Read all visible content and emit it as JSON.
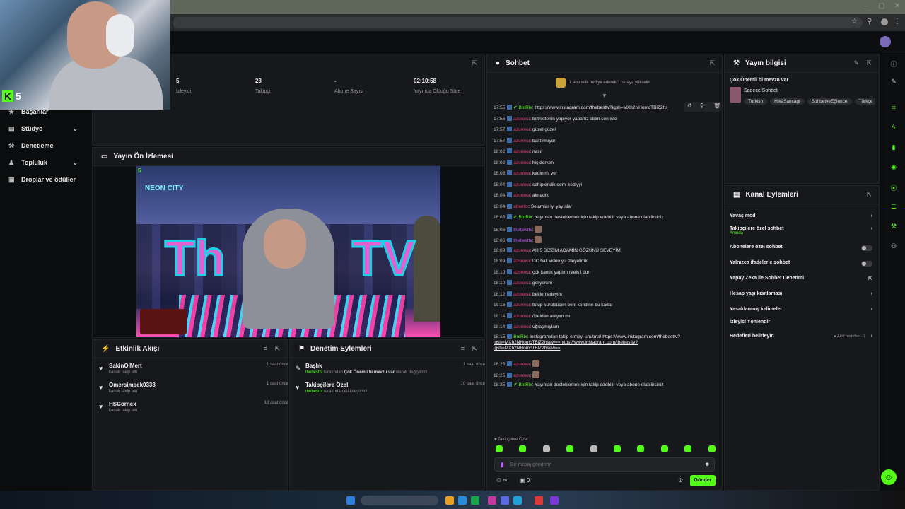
{
  "webcam": {
    "brand_letter": "K",
    "brand_number": "5"
  },
  "sidebar": {
    "items": [
      {
        "label": "Başarılar",
        "icon": "award-icon"
      },
      {
        "label": "Stüdyo",
        "icon": "studio-icon",
        "expandable": true
      },
      {
        "label": "Denetleme",
        "icon": "wrench-icon"
      },
      {
        "label": "Topluluk",
        "icon": "community-icon",
        "expandable": true
      },
      {
        "label": "Droplar ve ödüller",
        "icon": "gift-icon"
      }
    ]
  },
  "stats": [
    {
      "value": "5",
      "label": "İzleyici"
    },
    {
      "value": "23",
      "label": "Takipçi"
    },
    {
      "value": "-",
      "label": "Abone Sayısı"
    },
    {
      "value": "02:10:58",
      "label": "Yayında Olduğu Süre"
    }
  ],
  "preview": {
    "title": "Yayın Ön İzlemesi",
    "badge": "5",
    "overlay_left": "Th",
    "overlay_right": "TV",
    "neon_text": "NEON CITY"
  },
  "activity": {
    "title": "Etkinlik Akışı",
    "items": [
      {
        "name": "SakinOlMert",
        "desc": "kanalı takip etti",
        "time": "1 saat önce"
      },
      {
        "name": "Omersimsek0333",
        "desc": "kanalı takip etti",
        "time": "1 saat önce"
      },
      {
        "name": "HSCornex",
        "desc": "kanalı takip etti",
        "time": "18 saat önce"
      }
    ]
  },
  "moderation": {
    "title": "Denetim Eylemleri",
    "items": [
      {
        "title": "Başlık",
        "user": "thebesttv",
        "pre": "tarafından",
        "bold": "Çok Önemli bi mevzu var",
        "post": "olarak değiştirildi",
        "time": "1 saat önce"
      },
      {
        "title": "Takipçilere Özel",
        "user": "thebesttv",
        "pre": "tarafından etkinleştirildi",
        "bold": "",
        "post": "",
        "time": "10 saat önce"
      }
    ]
  },
  "chat": {
    "title": "Sohbet",
    "gift_banner": "1 abonelik hediye ederek 1. sıraya yükselin",
    "messages": [
      {
        "time": "17:55",
        "user": "BotRix",
        "cls": "u2",
        "text": "",
        "link": "https://www.instagram.com/thebesttv?igsh=MXh2NHomcTBlZ2hs"
      },
      {
        "time": "17:56",
        "user": "azurexa",
        "cls": "u1",
        "text": "botrixdenin yapıyor yapanız abim sen iste"
      },
      {
        "time": "17:57",
        "user": "azurexa",
        "cls": "u1",
        "text": "güzel güzel"
      },
      {
        "time": "17:57",
        "user": "azurexa",
        "cls": "u1",
        "text": "bastırmıyor"
      },
      {
        "time": "18:02",
        "user": "azurexa",
        "cls": "u1",
        "text": "nasıl"
      },
      {
        "time": "18:02",
        "user": "azurexa",
        "cls": "u1",
        "text": "hiç derken"
      },
      {
        "time": "18:03",
        "user": "azurexa",
        "cls": "u1",
        "text": "kedin mi ver"
      },
      {
        "time": "18:04",
        "user": "azurexa",
        "cls": "u1",
        "text": "sahiplendik demi kediyyi"
      },
      {
        "time": "18:04",
        "user": "azurexa",
        "cls": "u1",
        "text": "almadık"
      },
      {
        "time": "18:04",
        "user": "albertix",
        "cls": "u1",
        "text": "Selamlar iyi yayınlar"
      },
      {
        "time": "18:05",
        "user": "BotRix",
        "cls": "u2",
        "text": "Yayınları desteklemek için takip edebilir veya abone olabilirsiniz"
      },
      {
        "time": "18:06",
        "user": "thebesttv",
        "cls": "u3",
        "text": "",
        "emote": true
      },
      {
        "time": "18:06",
        "user": "thebesttv",
        "cls": "u3",
        "text": "",
        "emote": true
      },
      {
        "time": "18:09",
        "user": "azurexa",
        "cls": "u1",
        "text": "AH 5 BİZZİM ADAMIN GÖZÜNÜ SEVEYİM"
      },
      {
        "time": "18:09",
        "user": "azurexa",
        "cls": "u1",
        "text": "DC bak video yu izleyelimk"
      },
      {
        "time": "18:10",
        "user": "azurexa",
        "cls": "u1",
        "text": "çok kaotik yaptım reels l dur"
      },
      {
        "time": "18:10",
        "user": "azurexa",
        "cls": "u1",
        "text": "geliyorum"
      },
      {
        "time": "18:12",
        "user": "azurexa",
        "cls": "u1",
        "text": "beklemedeyim"
      },
      {
        "time": "18:13",
        "user": "azurexa",
        "cls": "u1",
        "text": "tutup sürüklücen beni kendine bu kadar"
      },
      {
        "time": "18:14",
        "user": "azurexa",
        "cls": "u1",
        "text": "özelden arayım mı"
      },
      {
        "time": "18:14",
        "user": "azurexa",
        "cls": "u1",
        "text": "uğraşmıylam"
      }
    ],
    "botrix_long": {
      "time": "18:15",
      "user": "BotRix",
      "text": "Instagramdan takip etmeyi unutma!",
      "link1": "https://www.instagram.com/thebesttv?",
      "link2": "igsh=MXh2NHomcTBlZ2hsaw==https://www.instagram.com/thebesttv?",
      "link3": "igsh=MXh2NHomcTBlZ2hsaw=="
    },
    "tail": [
      {
        "time": "18:25",
        "user": "azurexa",
        "cls": "u1",
        "text": "",
        "emote": true
      },
      {
        "time": "18:25",
        "user": "azurexa",
        "cls": "u1",
        "text": "",
        "emote": true
      },
      {
        "time": "18:25",
        "user": "BotRix",
        "cls": "u2",
        "text": "Yayınları desteklemek için takip edebilir veya abone olabilirsiniz"
      }
    ],
    "mode_label": "Takipçilere Özel",
    "input_placeholder": "Bir mesaj gönderin",
    "points": "0",
    "send_label": "Gönder"
  },
  "stream_info": {
    "title": "Yayın bilgisi",
    "stream_title": "Çok Önemli bi mevzu var",
    "category": "Sadece Sohbet",
    "tags": [
      "Turkish",
      "HikâSancagi",
      "SohbetveEğlence",
      "Türkçe"
    ]
  },
  "channel_actions": {
    "title": "Kanal Eylemleri",
    "items": [
      {
        "label": "Yavaş mod",
        "kind": "chevron"
      },
      {
        "label": "Takipçilere özel sohbet",
        "sub": "Anında",
        "kind": "chevron"
      },
      {
        "label": "Abonelere özel sohbet",
        "kind": "toggle"
      },
      {
        "label": "Yalnızca ifadelerle sohbet",
        "kind": "toggle"
      },
      {
        "label": "Yapay Zeka ile Sohbet Denetimi",
        "kind": "link"
      },
      {
        "label": "Hesap yaşı kısıtlaması",
        "kind": "chevron"
      },
      {
        "label": "Yasaklanmış kelimeler",
        "kind": "chevron"
      },
      {
        "label": "İzleyici Yönlendir",
        "kind": "none"
      },
      {
        "label": "Hedefleri belirleyin",
        "kind": "goals",
        "extra": "Aktif hedefler - 1"
      }
    ]
  },
  "colors": {
    "accent": "#53fc18",
    "panel": "#17181b",
    "bg": "#0b0c0e"
  }
}
